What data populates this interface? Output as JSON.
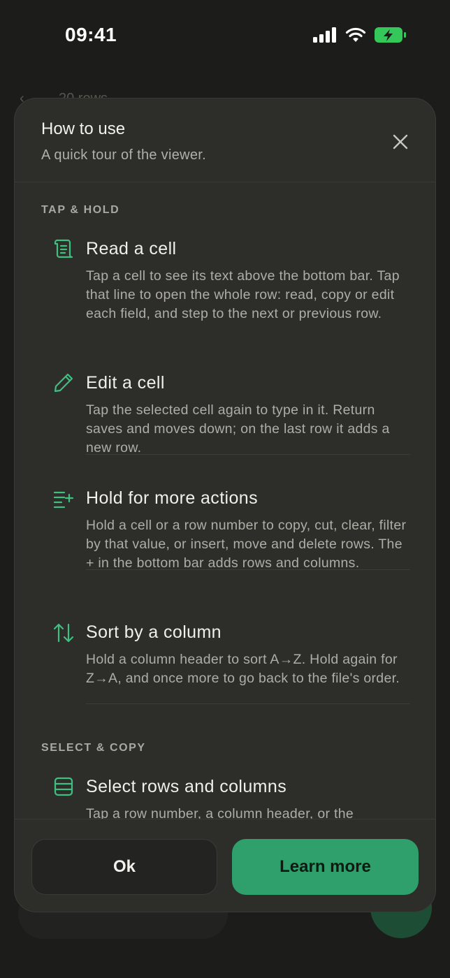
{
  "status_bar": {
    "time": "09:41"
  },
  "background": {
    "toolbar_text": "20 rows"
  },
  "dialog": {
    "title": "How to use",
    "subtitle": "A quick tour of the viewer.",
    "sections": [
      {
        "label": "TAP & HOLD",
        "items": [
          {
            "icon": "scroll-icon",
            "title": "Read a cell",
            "body": "Tap a cell to see its text above the bottom bar. Tap that line to open the whole row: read, copy or edit each field, and step to the next or previous row."
          },
          {
            "icon": "pencil-icon",
            "title": "Edit a cell",
            "body": "Tap the selected cell again to type in it. Return saves and moves down; on the last row it adds a new row."
          },
          {
            "icon": "list-add-icon",
            "title": "Hold for more actions",
            "body": "Hold a cell or a row number to copy, cut, clear, filter by that value, or insert, move and delete rows. The + in the bottom bar adds rows and columns."
          },
          {
            "icon": "sort-arrows-icon",
            "title": "Sort by a column",
            "body": "Hold a column header to sort A→Z. Hold again for Z→A, and once more to go back to the file's order."
          }
        ]
      },
      {
        "label": "SELECT & COPY",
        "items": [
          {
            "icon": "rows-icon",
            "title": "Select rows and columns",
            "body": "Tap a row number, a column header, or the"
          }
        ]
      }
    ],
    "buttons": {
      "ok": "Ok",
      "learn_more": "Learn more"
    }
  },
  "colors": {
    "accent": "#2f9f6b",
    "icon_green": "#3fbf80",
    "sheet": "#2d2d2a"
  }
}
